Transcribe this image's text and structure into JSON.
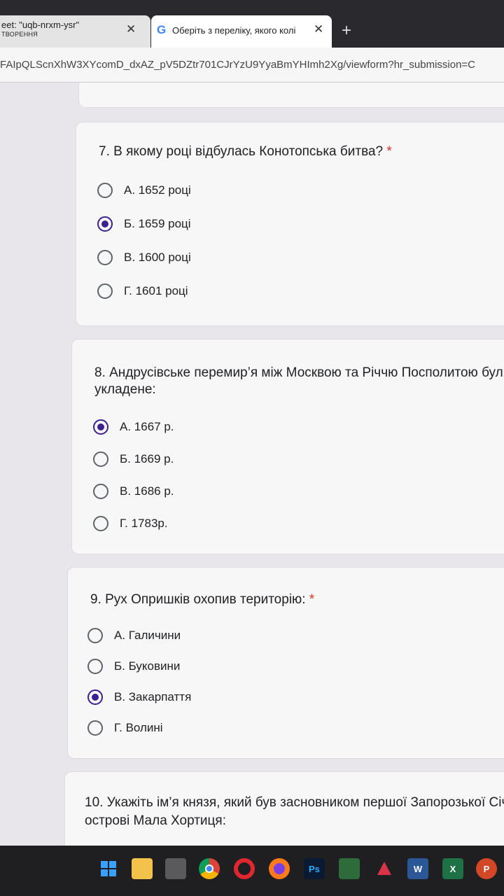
{
  "browser": {
    "tab1": {
      "title_line1": "eet: \"uqb-nrxm-ysr\"",
      "title_line2": "ТВОРЕННЯ",
      "close": "✕"
    },
    "tab2": {
      "icon": "G",
      "title": "Оберіть з переліку, якого колі",
      "close": "✕"
    },
    "new_tab": "+",
    "url": "FAIpQLScnXhW3XYcomD_dxAZ_pV5DZtr701CJrYzU9YyaBmYHImh2Xg/viewform?hr_submission=C"
  },
  "questions": [
    {
      "number_title": "7. В якому році відбулась Конотопська битва?",
      "required": "*",
      "options": [
        "А. 1652 році",
        "Б. 1659 році",
        "В. 1600 році",
        "Г. 1601 році"
      ],
      "selected_index": 1
    },
    {
      "number_title_line1": "8. Андрусівське перемир’я між Москвою та Річчю Посполитою бул",
      "number_title_line2": "укладене:",
      "options": [
        "А. 1667 р.",
        "Б. 1669 р.",
        "В. 1686 р.",
        "Г. 1783р."
      ],
      "selected_index": 0
    },
    {
      "number_title": "9. Рух Опришків охопив територію:",
      "required": "*",
      "options": [
        "А. Галичини",
        "Б. Буковини",
        "В. Закарпаття",
        "Г. Волині"
      ],
      "selected_index": 2
    },
    {
      "number_title_line1": "10. Укажіть ім’я князя, який був засновником першої Запорозької Січі",
      "number_title_line2": "острові Мала Хортиця:"
    }
  ],
  "taskbar": {
    "icons": [
      "windows-start-icon",
      "file-explorer-icon",
      "calculator-icon",
      "chrome-icon",
      "opera-icon",
      "firefox-icon",
      "photoshop-icon",
      "solitaire-icon",
      "paint-icon",
      "word-icon",
      "excel-icon",
      "powerpoint-icon"
    ],
    "labels": {
      "photoshop": "Ps",
      "word": "W",
      "excel": "X",
      "powerpoint": "P"
    }
  },
  "colors": {
    "accent": "#3d1f8f",
    "required": "#d93025"
  }
}
